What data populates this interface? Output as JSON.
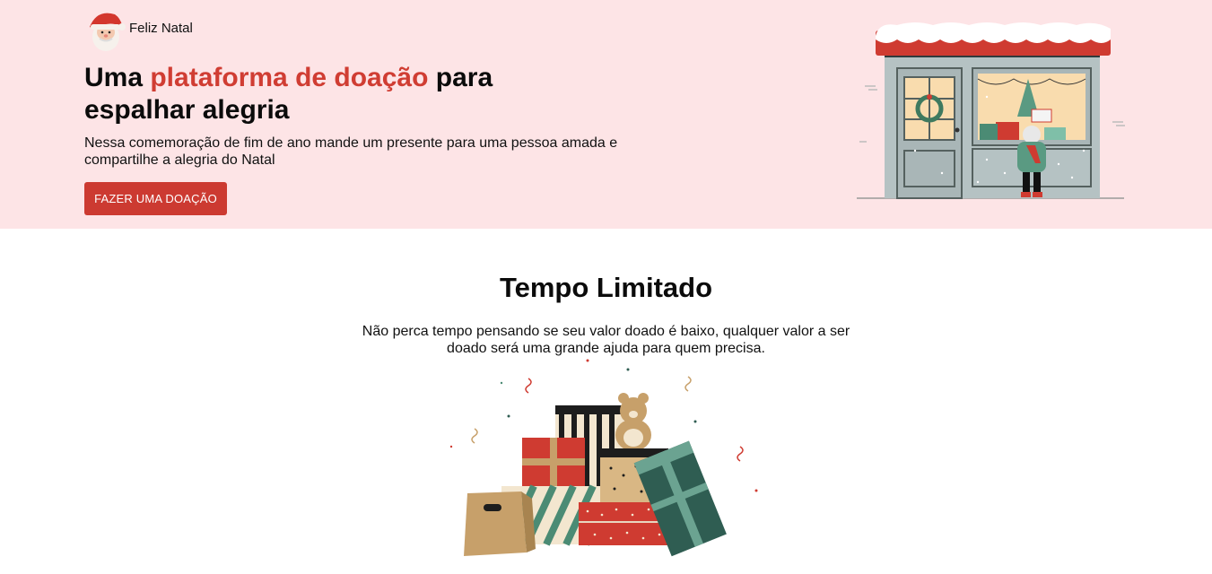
{
  "header": {
    "brand_name": "Feliz Natal",
    "logo_icon": "santa-claus-icon"
  },
  "hero": {
    "title_part1": "Uma ",
    "title_highlight": "plataforma de doação",
    "title_part2": " para espalhar alegria",
    "text": "Nessa comemoração de fim de ano mande um presente para uma pessoa amada e compartilhe a alegria do Natal",
    "cta_label": "FAZER UMA DOAÇÃO",
    "illustration": "christmas-shop-window-illustration"
  },
  "limited": {
    "title": "Tempo Limitado",
    "text": "Não perca tempo pensando se seu valor doado é baixo, qualquer valor a ser doado será uma grande ajuda para quem precisa.",
    "illustration": "gift-pile-illustration"
  },
  "colors": {
    "hero_bg": "#fde4e6",
    "accent": "#cc3a31",
    "highlight_text": "#d03d33"
  }
}
